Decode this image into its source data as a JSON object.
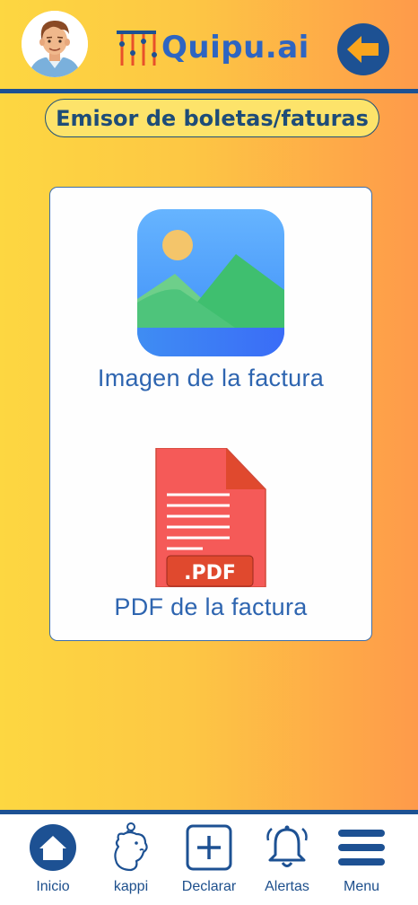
{
  "header": {
    "logo_text": "Quipu.ai"
  },
  "page_title": "Emisor de boletas/faturas",
  "options": [
    {
      "label": "Imagen de la factura",
      "icon": "image-icon"
    },
    {
      "label": "PDF de la factura",
      "icon": "pdf-file-icon",
      "badge": ".PDF"
    }
  ],
  "bottom_nav": [
    {
      "label": "Inicio",
      "icon": "home-icon"
    },
    {
      "label": "kappi",
      "icon": "capybara-icon"
    },
    {
      "label": "Declarar",
      "icon": "plus-box-icon"
    },
    {
      "label": "Alertas",
      "icon": "bell-icon"
    },
    {
      "label": "Menu",
      "icon": "hamburger-icon"
    }
  ],
  "colors": {
    "primary": "#1d5193",
    "text_blue": "#2e65b0",
    "gradient_start": "#fdd741",
    "gradient_end": "#fe9a4a",
    "pdf_red": "#f55a58"
  }
}
